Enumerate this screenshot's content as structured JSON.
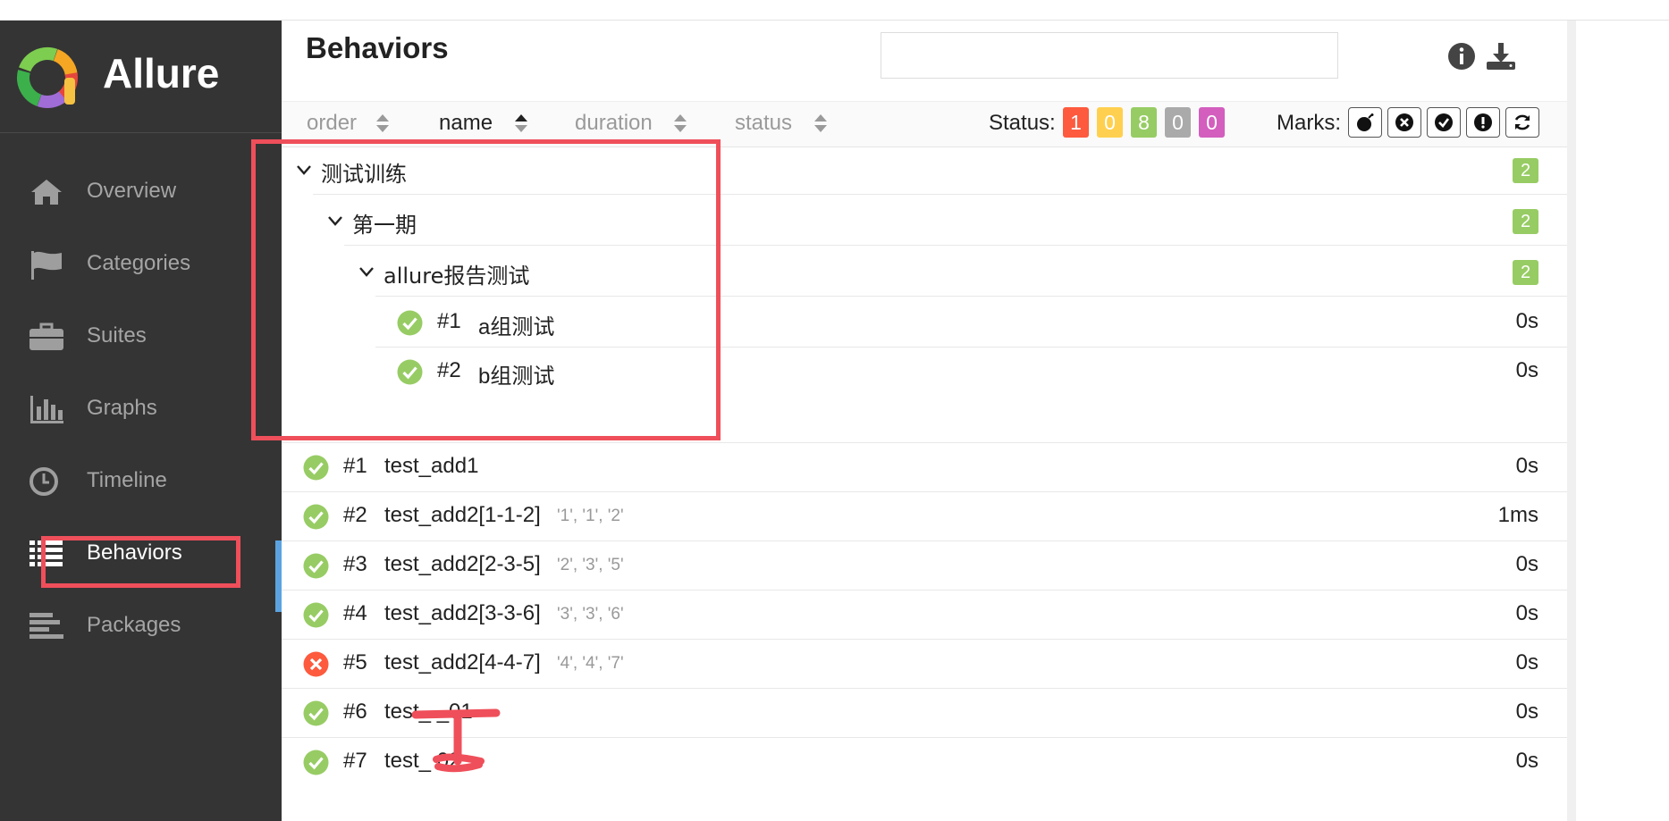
{
  "brand": {
    "name": "Allure"
  },
  "nav": [
    {
      "label": "Overview",
      "icon": "home-icon"
    },
    {
      "label": "Categories",
      "icon": "flag-icon"
    },
    {
      "label": "Suites",
      "icon": "briefcase-icon"
    },
    {
      "label": "Graphs",
      "icon": "bar-chart-icon"
    },
    {
      "label": "Timeline",
      "icon": "clock-icon"
    },
    {
      "label": "Behaviors",
      "icon": "list-icon",
      "active": true
    },
    {
      "label": "Packages",
      "icon": "align-left-icon"
    }
  ],
  "header": {
    "title": "Behaviors",
    "search_placeholder": ""
  },
  "toolbar": {
    "sort": {
      "order": "order",
      "name": "name",
      "duration": "duration",
      "status": "status"
    },
    "status_label": "Status:",
    "status_counts": [
      {
        "value": "1",
        "color": "#fd5a3e"
      },
      {
        "value": "0",
        "color": "#ffd050"
      },
      {
        "value": "8",
        "color": "#97cc64"
      },
      {
        "value": "0",
        "color": "#aaaaaa"
      },
      {
        "value": "0",
        "color": "#d35ebe"
      }
    ],
    "marks_label": "Marks:"
  },
  "tree": {
    "groups": [
      {
        "name": "测试训练",
        "count": "2"
      },
      {
        "name": "第一期",
        "count": "2"
      },
      {
        "name": "allure报告测试",
        "count": "2"
      }
    ],
    "nested_tests": [
      {
        "num": "#1",
        "name": "a组测试",
        "duration": "0s",
        "status": "passed"
      },
      {
        "num": "#2",
        "name": "b组测试",
        "duration": "0s",
        "status": "passed"
      }
    ]
  },
  "tests": [
    {
      "num": "#1",
      "name": "test_add1",
      "params": "",
      "duration": "0s",
      "status": "passed"
    },
    {
      "num": "#2",
      "name": "test_add2[1-1-2]",
      "params": "'1', '1', '2'",
      "duration": "1ms",
      "status": "passed"
    },
    {
      "num": "#3",
      "name": "test_add2[2-3-5]",
      "params": "'2', '3', '5'",
      "duration": "0s",
      "status": "passed"
    },
    {
      "num": "#4",
      "name": "test_add2[3-3-6]",
      "params": "'3', '3', '6'",
      "duration": "0s",
      "status": "passed"
    },
    {
      "num": "#5",
      "name": "test_add2[4-4-7]",
      "params": "'4', '4', '7'",
      "duration": "0s",
      "status": "failed"
    },
    {
      "num": "#6",
      "name": "test_    _01",
      "params": "",
      "duration": "0s",
      "status": "passed"
    },
    {
      "num": "#7",
      "name": "test_      02",
      "params": "",
      "duration": "0s",
      "status": "passed"
    }
  ],
  "colors": {
    "passed": "#97cc64",
    "failed": "#fd5a3e",
    "annotation": "#ef4f5a",
    "sidebar": "#343434",
    "active_accent": "#5ba3e0"
  }
}
